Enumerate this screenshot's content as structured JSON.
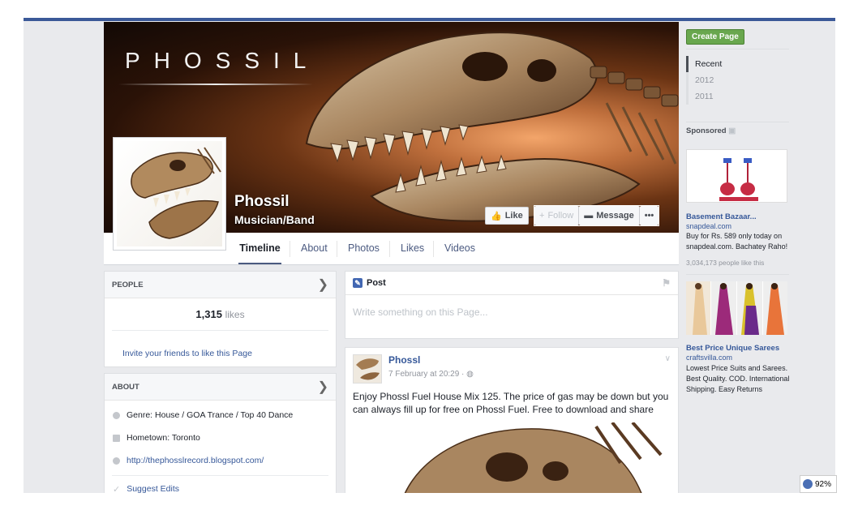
{
  "cover": {
    "brand": "PHOSSIL"
  },
  "page": {
    "name": "Phossil",
    "category": "Musician/Band"
  },
  "actions": {
    "like": "Like",
    "follow": "Follow",
    "message": "Message",
    "more": "•••"
  },
  "tabs": [
    "Timeline",
    "About",
    "Photos",
    "Likes",
    "Videos"
  ],
  "people": {
    "header": "PEOPLE",
    "likes_count": "1,315",
    "likes_label": "likes",
    "invite": "Invite your friends to like this Page"
  },
  "about": {
    "header": "ABOUT",
    "genre": "Genre: House / GOA Trance / Top 40 Dance",
    "hometown": "Hometown: Toronto",
    "website": "http://thephosslrecord.blogspot.com/",
    "suggest": "Suggest Edits"
  },
  "composer": {
    "label": "Post",
    "placeholder": "Write something on this Page..."
  },
  "feed": {
    "author": "Phossl",
    "time": "7 February at 20:29 · ",
    "text": "Enjoy Phossl Fuel House Mix 125. The price of gas may be down but you can always fill up for free on Phossl Fuel. Free to download and share"
  },
  "right": {
    "create_page": "Create Page",
    "years": [
      "Recent",
      "2012",
      "2011"
    ],
    "sponsored": "Sponsored",
    "ads": [
      {
        "title": "Basement Bazaar...",
        "url": "snapdeal.com",
        "body": "Buy for Rs. 589 only today on snapdeal.com. Bachatey Raho!",
        "likes": "3,034,173 people like this"
      },
      {
        "title": "Best Price Unique Sarees",
        "url": "craftsvilla.com",
        "body": "Lowest Price Suits and Sarees. Best Quality. COD. International Shipping. Easy Returns"
      }
    ]
  },
  "zoom": "92%"
}
